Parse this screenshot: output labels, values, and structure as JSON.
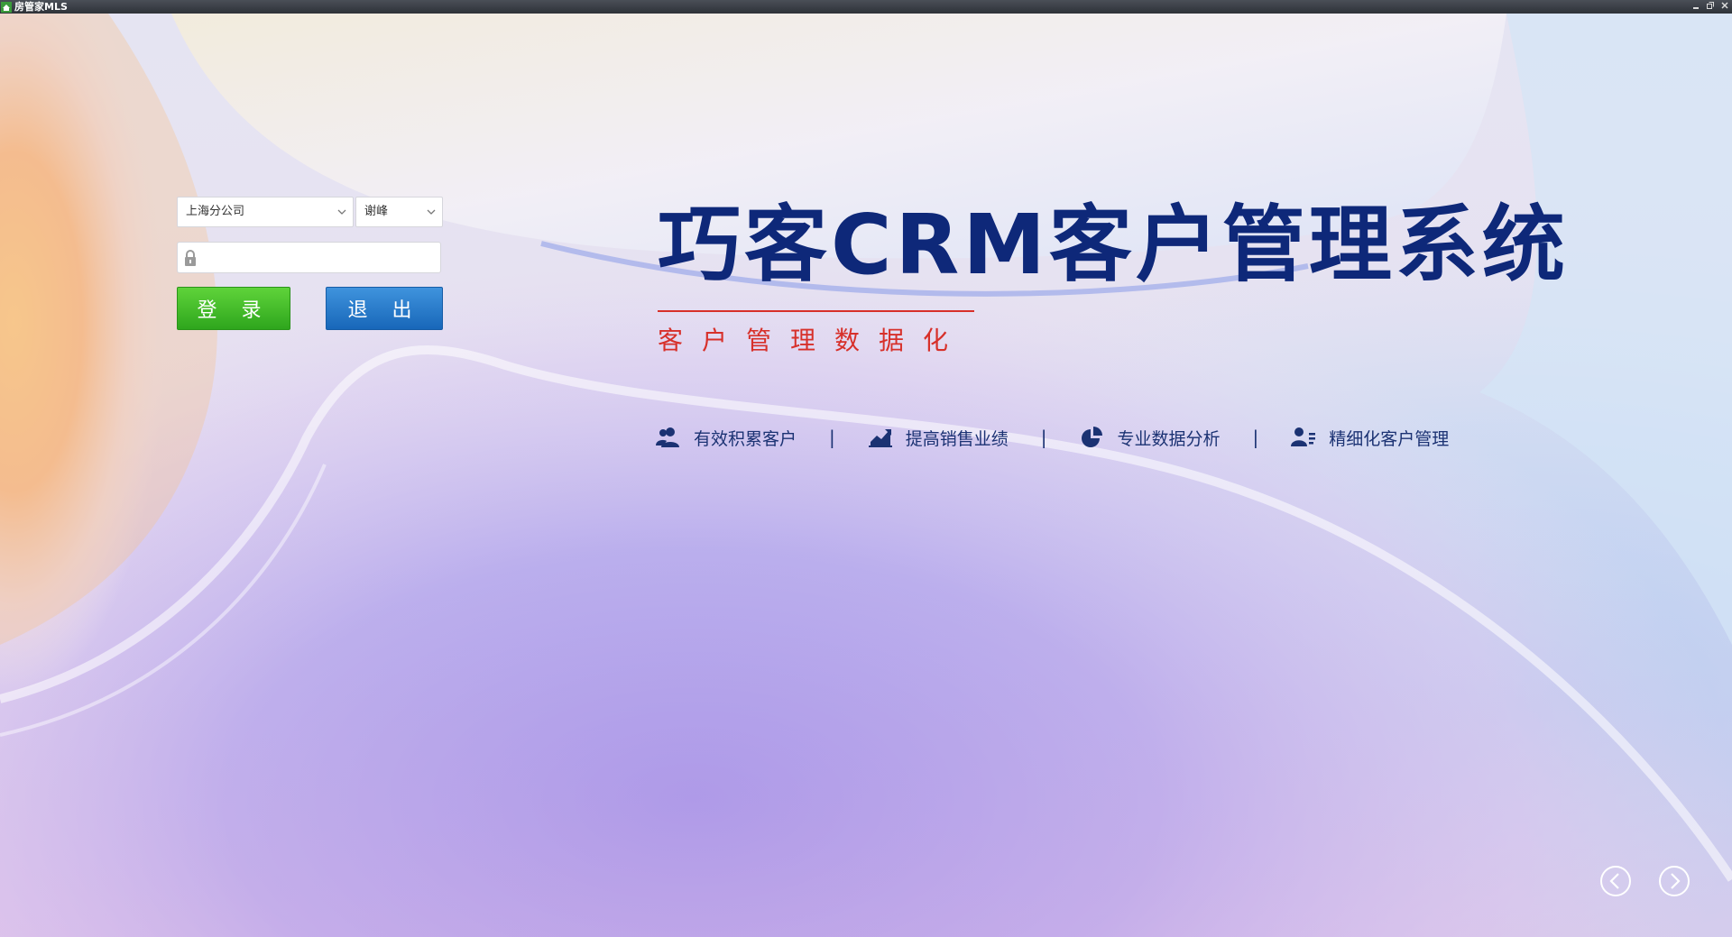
{
  "window": {
    "title": "房管家MLS",
    "controls": [
      "minimize-icon",
      "restore-icon",
      "close-icon"
    ]
  },
  "login": {
    "company_value": "上海分公司",
    "user_value": "谢峰",
    "password_value": "",
    "login_label": "登 录",
    "exit_label": "退 出"
  },
  "hero": {
    "title": "巧客CRM客户管理系统",
    "subtitle": "客户管理数据化"
  },
  "features": [
    {
      "icon": "users-icon",
      "label": "有效积累客户"
    },
    {
      "icon": "trend-chart-icon",
      "label": "提高销售业绩"
    },
    {
      "icon": "pie-chart-icon",
      "label": "专业数据分析"
    },
    {
      "icon": "user-list-icon",
      "label": "精细化客户管理"
    }
  ],
  "feature_separator": "|",
  "colors": {
    "title": "#0e2879",
    "accent_red": "#d7302a",
    "login_green": "#3db928",
    "exit_blue": "#2379cb",
    "feature_text": "#1b3273"
  }
}
